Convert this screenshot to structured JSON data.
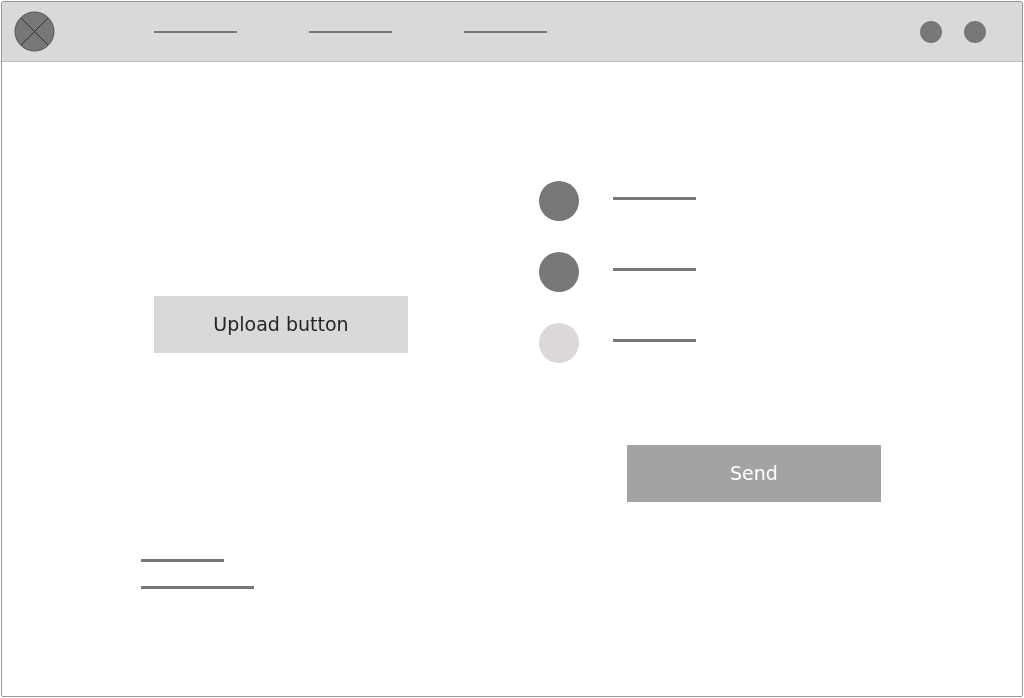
{
  "upload_button": {
    "label": "Upload button"
  },
  "options": [
    {
      "checked": true
    },
    {
      "checked": true
    },
    {
      "checked": false
    }
  ],
  "send_button": {
    "label": "Send",
    "disabled": true
  }
}
